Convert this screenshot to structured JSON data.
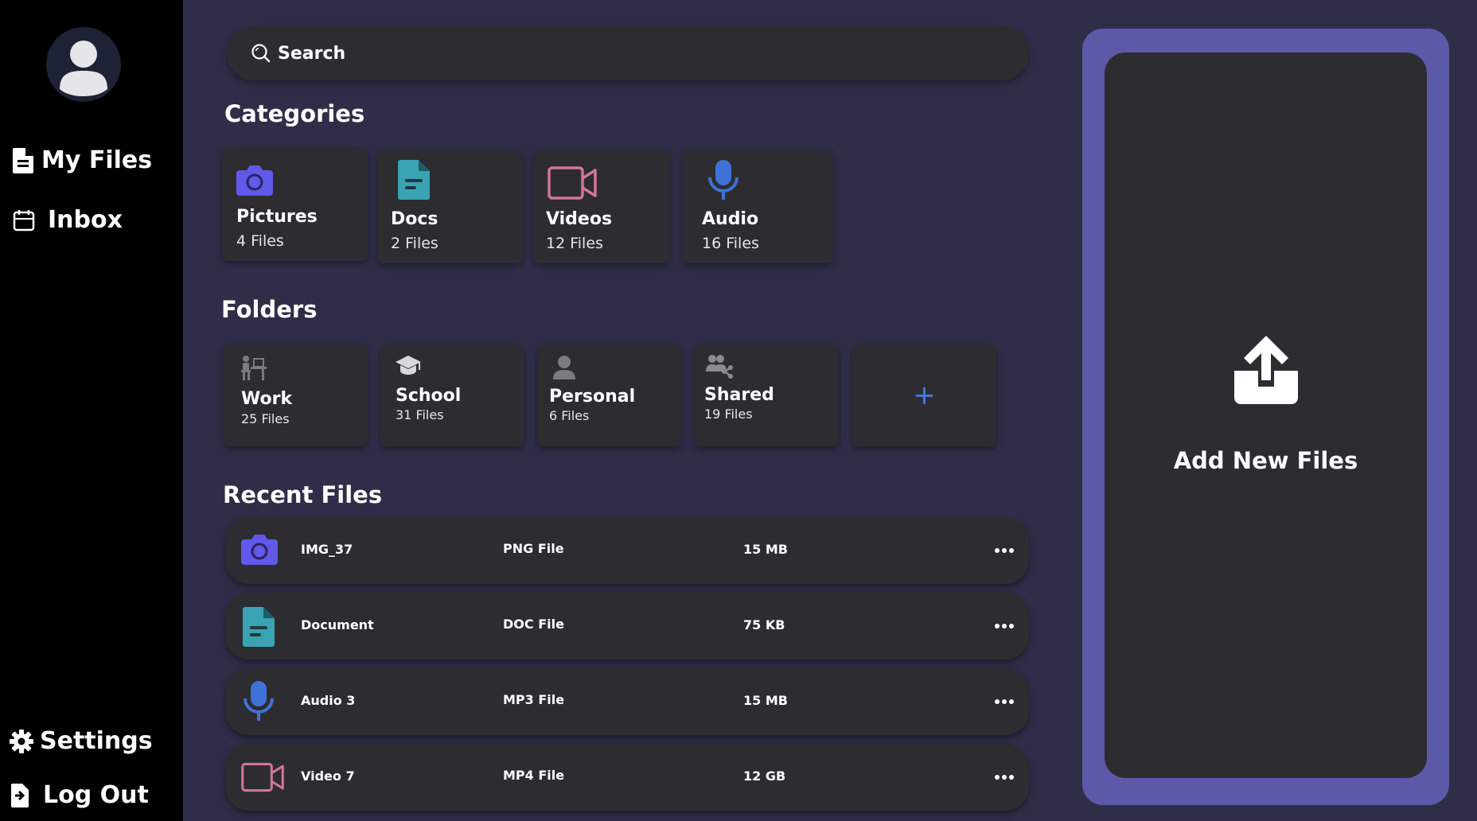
{
  "sidebar": {
    "nav": [
      {
        "label": "My Files",
        "icon": "file-icon"
      },
      {
        "label": "Inbox",
        "icon": "inbox-icon"
      }
    ],
    "bottom": [
      {
        "label": "Settings",
        "icon": "gear-icon"
      },
      {
        "label": "Log Out",
        "icon": "logout-icon"
      }
    ]
  },
  "search": {
    "label": "Search"
  },
  "categories": {
    "title": "Categories",
    "items": [
      {
        "label": "Pictures",
        "count": "4 Files",
        "icon": "camera-icon",
        "color": "#6059ea"
      },
      {
        "label": "Docs",
        "count": "2 Files",
        "icon": "document-icon",
        "color": "#3aa3b3"
      },
      {
        "label": "Videos",
        "count": "12 Files",
        "icon": "video-icon",
        "color": "#d2759a"
      },
      {
        "label": "Audio",
        "count": "16 Files",
        "icon": "microphone-icon",
        "color": "#3f72d8"
      }
    ]
  },
  "folders": {
    "title": "Folders",
    "items": [
      {
        "label": "Work",
        "count": "25 Files",
        "icon": "desk-worker-icon"
      },
      {
        "label": "School",
        "count": "31 Files",
        "icon": "graduation-cap-icon"
      },
      {
        "label": "Personal",
        "count": "6 Files",
        "icon": "person-icon"
      },
      {
        "label": "Shared",
        "count": "19 Files",
        "icon": "shared-users-icon"
      }
    ],
    "add_label": "+"
  },
  "recent": {
    "title": "Recent Files",
    "rows": [
      {
        "name": "IMG_37",
        "type": "PNG File",
        "size": "15 MB",
        "icon": "camera-icon"
      },
      {
        "name": "Document",
        "type": "DOC File",
        "size": "75 KB",
        "icon": "document-icon"
      },
      {
        "name": "Audio 3",
        "type": "MP3 File",
        "size": "15 MB",
        "icon": "microphone-icon"
      },
      {
        "name": "Video 7",
        "type": "MP4 File",
        "size": "12 GB",
        "icon": "video-icon"
      }
    ]
  },
  "upload": {
    "label": "Add New Files",
    "icon": "upload-icon"
  },
  "colors": {
    "background": "#2f2e48",
    "sidebar": "#000000",
    "card": "#2d2d31",
    "upload_frame": "#5c59a8",
    "accent_blue": "#3f7ce0"
  }
}
